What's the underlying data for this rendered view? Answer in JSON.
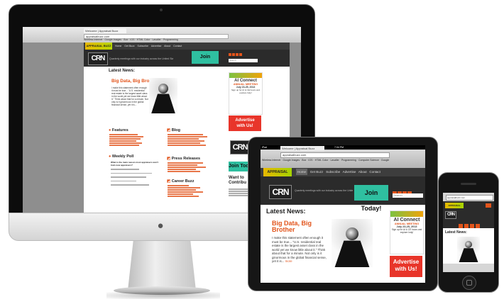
{
  "browser": {
    "tab_title": "Welcome | Appraisal Buzz",
    "url": "appraisalbuzz.com",
    "bookmarks": [
      "Wireless Internet",
      "Google Images",
      "Box",
      "IOS",
      "HTML Color",
      "Lavalier",
      "Programming",
      "Computer Science",
      "Google"
    ]
  },
  "site": {
    "logo": "APPRAISAL BUZZ",
    "nav_items": [
      "Home",
      "Get Buzz",
      "Subscribe",
      "Advertise",
      "About",
      "Contact"
    ],
    "crn_logo": "CRN",
    "header_tagline": "Quarterly meetings with our industry across the United States",
    "join_button": "Join Today!",
    "search_placeholder": "Search",
    "latest_news_heading": "Latest News:",
    "headline": "Big Data, Big Brother",
    "headline_line1": "Big Data, Big",
    "headline_line2": "Brother",
    "teaser": "I make this statement often enough it must be true... \"U.S. residential real estate is the largest asset class in the world yet we know little about it.\" Think about that for a minute. Not only is it ginormous in the global financial sense, yet it is...",
    "more_link": "more",
    "ad_brand": "AI Connect",
    "ad_title": "ANNUAL MEETING",
    "ad_dates": "July 23-25, 2013",
    "ad_cta": "Sign up for AI & CE hours and explore Indy!",
    "advertise_line1": "Advertise",
    "advertise_line2": "with Us!",
    "sections": {
      "features": "Features",
      "blog": "Blog",
      "weekly_poll": "Weekly Poll",
      "press_releases": "Press Releases",
      "career_buzz": "Career Buzz"
    },
    "poll_question": "What is the main reason most appraisers won't train new appraisers?",
    "contributor_heading": "Want to Contribute?",
    "contributor_short": "Want to",
    "contributor_short2": "Contribu"
  },
  "ipad": {
    "status_left": "iPad",
    "status_time": "7:34 PM"
  },
  "colors": {
    "accent_orange": "#e2541b",
    "join_teal": "#2fbfa0",
    "header_dark": "#2b2b2b",
    "advertise_red": "#e8352a"
  }
}
